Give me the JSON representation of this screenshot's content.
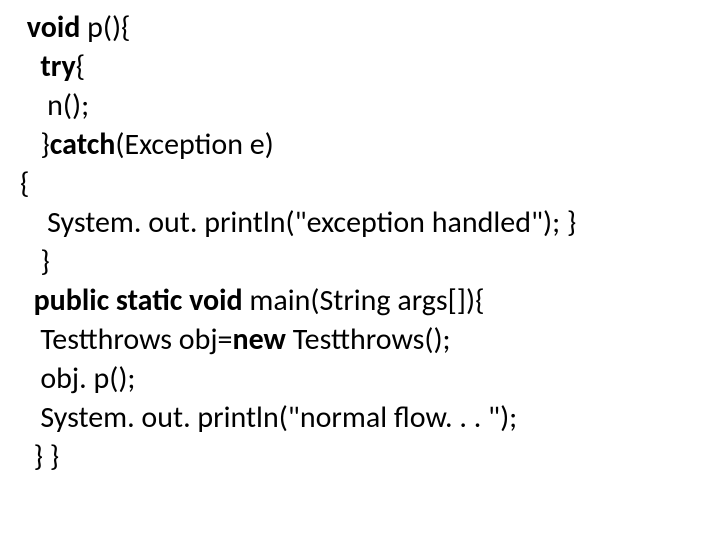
{
  "code": {
    "lines": [
      {
        "segments": [
          {
            "bold": true,
            "text": " void"
          },
          {
            "bold": false,
            "text": " p(){"
          }
        ]
      },
      {
        "segments": [
          {
            "bold": true,
            "text": "   try"
          },
          {
            "bold": false,
            "text": "{"
          }
        ]
      },
      {
        "segments": [
          {
            "bold": false,
            "text": "    n();"
          }
        ]
      },
      {
        "segments": [
          {
            "bold": false,
            "text": "   }"
          },
          {
            "bold": true,
            "text": "catch"
          },
          {
            "bold": false,
            "text": "(Exception e)"
          }
        ]
      },
      {
        "segments": [
          {
            "bold": false,
            "text": "{"
          }
        ]
      },
      {
        "segments": [
          {
            "bold": false,
            "text": "    System. out. println(\"exception handled\"); }"
          }
        ]
      },
      {
        "segments": [
          {
            "bold": false,
            "text": "   }"
          }
        ]
      },
      {
        "segments": [
          {
            "bold": true,
            "text": "  public static void"
          },
          {
            "bold": false,
            "text": " main(String args[]){"
          }
        ]
      },
      {
        "segments": [
          {
            "bold": false,
            "text": "   Testthrows obj="
          },
          {
            "bold": true,
            "text": "new"
          },
          {
            "bold": false,
            "text": " Testthrows();"
          }
        ]
      },
      {
        "segments": [
          {
            "bold": false,
            "text": "   obj. p();"
          }
        ]
      },
      {
        "segments": [
          {
            "bold": false,
            "text": "   System. out. println(\"normal flow. . . \");"
          }
        ]
      },
      {
        "segments": [
          {
            "bold": false,
            "text": "  } }"
          }
        ]
      }
    ]
  }
}
